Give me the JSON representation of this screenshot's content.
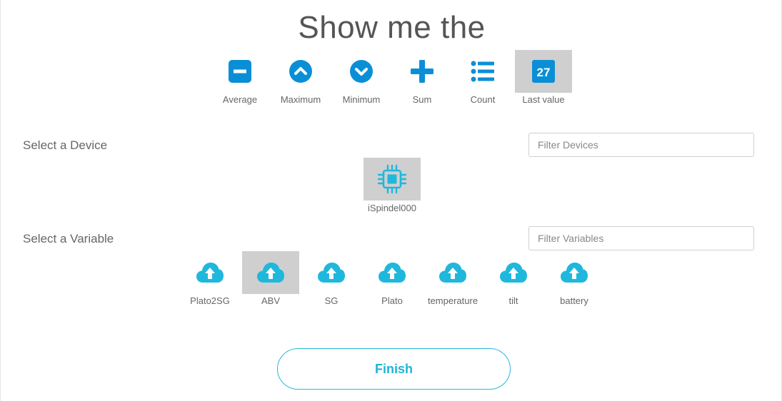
{
  "title": "Show me the",
  "aggregations": [
    {
      "label": "Average",
      "icon": "minus-square-icon"
    },
    {
      "label": "Maximum",
      "icon": "chevron-up-circle-icon"
    },
    {
      "label": "Minimum",
      "icon": "chevron-down-circle-icon"
    },
    {
      "label": "Sum",
      "icon": "plus-icon"
    },
    {
      "label": "Count",
      "icon": "list-icon"
    },
    {
      "label": "Last value",
      "icon": "calendar-icon",
      "badge": "27",
      "selected": true
    }
  ],
  "device_section": {
    "label": "Select a Device",
    "filter_placeholder": "Filter Devices",
    "devices": [
      {
        "label": "iSpindel000",
        "icon": "chip-icon",
        "selected": true
      }
    ]
  },
  "variable_section": {
    "label": "Select a Variable",
    "filter_placeholder": "Filter Variables",
    "variables": [
      {
        "label": "Plato2SG",
        "icon": "cloud-upload-icon"
      },
      {
        "label": "ABV",
        "icon": "cloud-upload-icon",
        "selected": true
      },
      {
        "label": "SG",
        "icon": "cloud-upload-icon"
      },
      {
        "label": "Plato",
        "icon": "cloud-upload-icon"
      },
      {
        "label": "temperature",
        "icon": "cloud-upload-icon"
      },
      {
        "label": "tilt",
        "icon": "cloud-upload-icon"
      },
      {
        "label": "battery",
        "icon": "cloud-upload-icon"
      }
    ]
  },
  "finish_label": "Finish",
  "colors": {
    "accent": "#0a8fd6",
    "variable_accent": "#1fb8dc",
    "selected_bg": "#cfcfcf"
  }
}
